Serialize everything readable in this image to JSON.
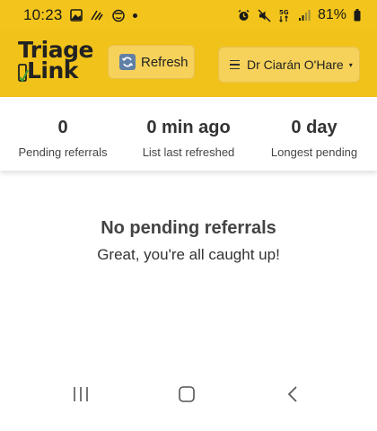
{
  "status_bar": {
    "time": "10:23",
    "network": "5G",
    "battery": "81%"
  },
  "header": {
    "logo_line1": "Triage",
    "logo_line2": "Link",
    "refresh_label": "Refresh",
    "user_label": "Dr Ciarán O'Hare",
    "caret": "▾"
  },
  "stats": [
    {
      "value": "0",
      "label": "Pending referrals"
    },
    {
      "value": "0 min ago",
      "label": "List last refreshed"
    },
    {
      "value": "0 day",
      "label": "Longest pending"
    }
  ],
  "empty_state": {
    "title": "No pending referrals",
    "subtitle": "Great, you're all caught up!"
  },
  "colors": {
    "header_bg": "#f1c21a",
    "button_bg": "#f6d25a",
    "logo_check": "#3a9a3a"
  },
  "icons": [
    "image-icon",
    "wifi-calling-icon",
    "face-icon",
    "alarm-icon",
    "mute-icon",
    "signal-icon",
    "battery-icon",
    "refresh-icon",
    "menu-icon",
    "recent-apps-icon",
    "home-icon",
    "back-icon"
  ]
}
